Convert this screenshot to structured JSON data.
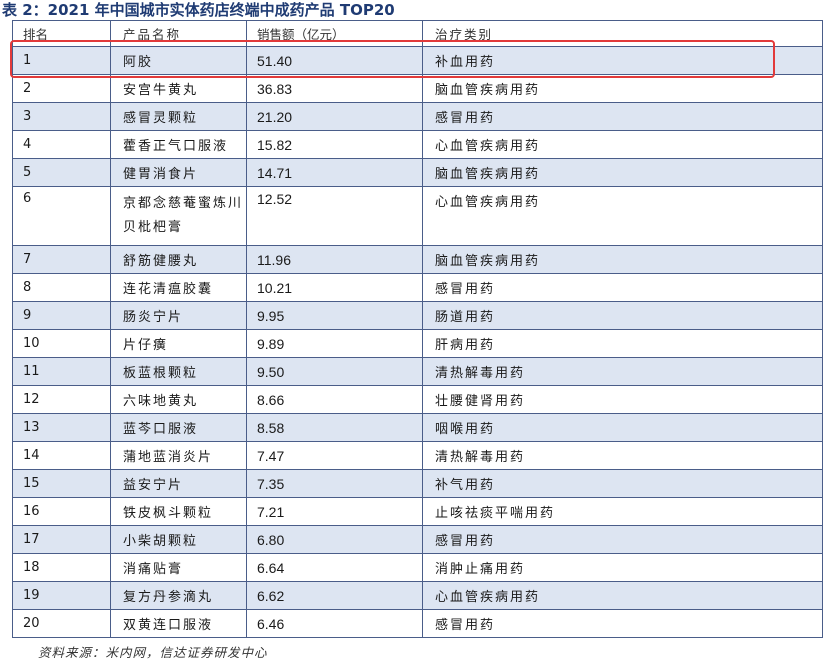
{
  "title": "表 2：2021 年中国城市实体药店终端中成药产品 TOP20",
  "headers": {
    "rank": "排名",
    "name": "产品名称",
    "sales": "销售额（亿元）",
    "category": "治疗类别"
  },
  "rows": [
    {
      "rank": "1",
      "name": "阿胶",
      "sales": "51.40",
      "category": "补血用药"
    },
    {
      "rank": "2",
      "name": "安宫牛黄丸",
      "sales": "36.83",
      "category": "脑血管疾病用药"
    },
    {
      "rank": "3",
      "name": "感冒灵颗粒",
      "sales": "21.20",
      "category": "感冒用药"
    },
    {
      "rank": "4",
      "name": "藿香正气口服液",
      "sales": "15.82",
      "category": "心血管疾病用药"
    },
    {
      "rank": "5",
      "name": "健胃消食片",
      "sales": "14.71",
      "category": "脑血管疾病用药"
    },
    {
      "rank": "6",
      "name": "京都念慈菴蜜炼川贝枇杷膏",
      "sales": "12.52",
      "category": "心血管疾病用药"
    },
    {
      "rank": "7",
      "name": "舒筋健腰丸",
      "sales": "11.96",
      "category": "脑血管疾病用药"
    },
    {
      "rank": "8",
      "name": "连花清瘟胶囊",
      "sales": "10.21",
      "category": "感冒用药"
    },
    {
      "rank": "9",
      "name": "肠炎宁片",
      "sales": "9.95",
      "category": "肠道用药"
    },
    {
      "rank": "10",
      "name": "片仔癀",
      "sales": "9.89",
      "category": "肝病用药"
    },
    {
      "rank": "11",
      "name": "板蓝根颗粒",
      "sales": "9.50",
      "category": "清热解毒用药"
    },
    {
      "rank": "12",
      "name": "六味地黄丸",
      "sales": "8.66",
      "category": "壮腰健肾用药"
    },
    {
      "rank": "13",
      "name": "蓝芩口服液",
      "sales": "8.58",
      "category": "咽喉用药"
    },
    {
      "rank": "14",
      "name": "蒲地蓝消炎片",
      "sales": "7.47",
      "category": "清热解毒用药"
    },
    {
      "rank": "15",
      "name": "益安宁片",
      "sales": "7.35",
      "category": "补气用药"
    },
    {
      "rank": "16",
      "name": "铁皮枫斗颗粒",
      "sales": "7.21",
      "category": "止咳祛痰平喘用药"
    },
    {
      "rank": "17",
      "name": "小柴胡颗粒",
      "sales": "6.80",
      "category": "感冒用药"
    },
    {
      "rank": "18",
      "name": "消痛贴膏",
      "sales": "6.64",
      "category": "消肿止痛用药"
    },
    {
      "rank": "19",
      "name": "复方丹参滴丸",
      "sales": "6.62",
      "category": "心血管疾病用药"
    },
    {
      "rank": "20",
      "name": "双黄连口服液",
      "sales": "6.46",
      "category": "感冒用药"
    }
  ],
  "source": "资料来源：米内网，信达证券研发中心",
  "colors": {
    "title": "#1f3b73",
    "stripe": "#dde5f2",
    "border": "#4a5d89",
    "highlight": "#e23a3a"
  }
}
